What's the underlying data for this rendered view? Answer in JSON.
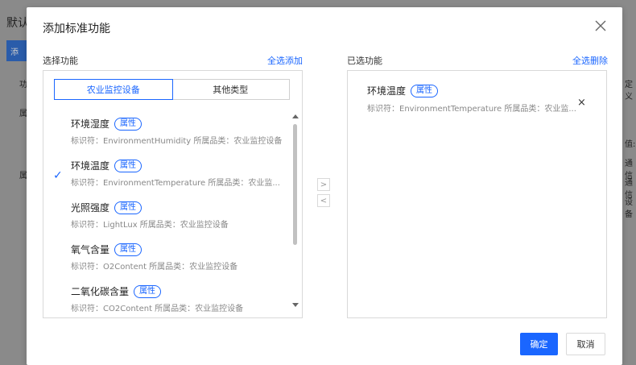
{
  "background": {
    "title_fragment": "默认",
    "button_fragment": "添",
    "col_fragment": "功",
    "row1_fragment": "属",
    "row2_fragment": "属",
    "right_col_fragment": "定义",
    "right_frag_1": "值:",
    "right_frag_2": "通信",
    "right_frag_3": "通信",
    "right_frag_4": "设备"
  },
  "dialog": {
    "title": "添加标准功能",
    "close_icon": "close-icon"
  },
  "left": {
    "label": "选择功能",
    "select_all": "全选添加",
    "tabs": [
      {
        "label": "农业监控设备",
        "active": true
      },
      {
        "label": "其他类型",
        "active": false
      }
    ],
    "items": [
      {
        "name": "环境湿度",
        "badge": "属性",
        "desc": "标识符：EnvironmentHumidity  所属品类：农业监控设备",
        "checked": false
      },
      {
        "name": "环境温度",
        "badge": "属性",
        "desc": "标识符：EnvironmentTemperature  所属品类：农业监...",
        "checked": true
      },
      {
        "name": "光照强度",
        "badge": "属性",
        "desc": "标识符：LightLux  所属品类：农业监控设备",
        "checked": false
      },
      {
        "name": "氧气含量",
        "badge": "属性",
        "desc": "标识符：O2Content  所属品类：农业监控设备",
        "checked": false
      },
      {
        "name": "二氧化碳含量",
        "badge": "属性",
        "desc": "标识符：CO2Content  所属品类：农业监控设备",
        "checked": false
      }
    ]
  },
  "transfer": {
    "add": ">",
    "remove": "<"
  },
  "right": {
    "label": "已选功能",
    "remove_all": "全选删除",
    "selected": [
      {
        "name": "环境温度",
        "badge": "属性",
        "desc": "标识符：EnvironmentTemperature  所属品类：农业监...",
        "remove": "×"
      }
    ]
  },
  "footer": {
    "confirm": "确定",
    "cancel": "取消"
  },
  "colors": {
    "accent": "#1a66ff",
    "overlay": "#8a8a8a"
  }
}
